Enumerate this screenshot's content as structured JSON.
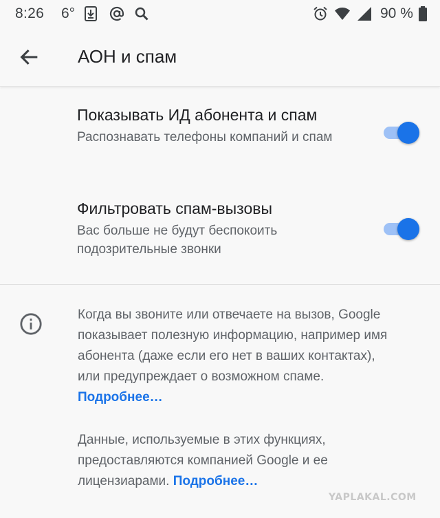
{
  "status_bar": {
    "time": "8:26",
    "temperature": "6°",
    "battery_percent": "90 %",
    "icons": [
      "download-icon",
      "at-icon",
      "search-icon",
      "alarm-icon",
      "wifi-icon",
      "signal-icon",
      "battery-icon"
    ]
  },
  "app_bar": {
    "title": "АОН и спам",
    "back_icon": "arrow-back-icon"
  },
  "settings": [
    {
      "title": "Показывать ИД абонента и спам",
      "summary": "Распознавать телефоны компаний и спам",
      "enabled": true
    },
    {
      "title": "Фильтровать спам-вызовы",
      "summary": "Вас больше не будут беспокоить подозрительные звонки",
      "enabled": true
    }
  ],
  "info": {
    "icon": "info-icon",
    "paragraph1": "Когда вы звоните или отвечаете на вызов, Google показывает полезную информацию, например имя абонента (даже если его нет в ваших контактах), или предупреждает о возможном спаме.",
    "paragraph1_link": "Подробнее…",
    "paragraph2": "Данные, используемые в этих функциях, предоставляются компанией Google и ее лицензиарами.",
    "paragraph2_link": "Подробнее…"
  },
  "colors": {
    "accent": "#1a73e8",
    "toggle_track": "#9ec1f6",
    "background": "#f8f8f8",
    "secondary_text": "#5f6368"
  },
  "watermark": "YAPLAKAL.COM"
}
